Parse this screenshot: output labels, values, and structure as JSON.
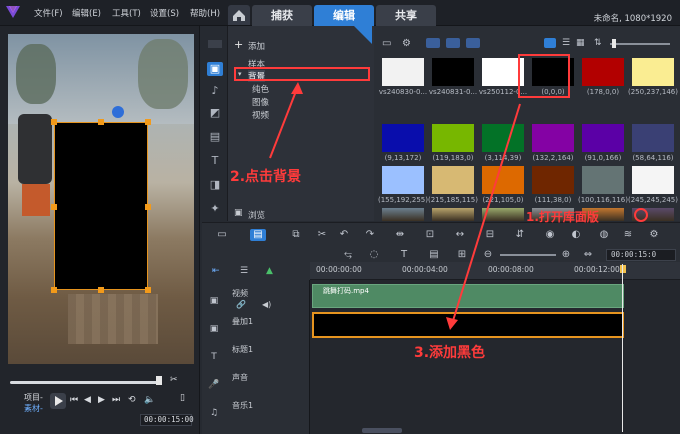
{
  "menubar": {
    "items": [
      "文件(F)",
      "编辑(E)",
      "工具(T)",
      "设置(S)",
      "帮助(H)"
    ]
  },
  "main_tabs": [
    {
      "label": "捕获",
      "active": false
    },
    {
      "label": "编辑",
      "active": true
    },
    {
      "label": "共享",
      "active": false
    }
  ],
  "project_info": "未命名, 1080*1920",
  "library": {
    "add_label": "添加",
    "nav": {
      "sample": "样本",
      "background": "背景",
      "children": [
        "纯色",
        "图像",
        "视频"
      ],
      "browse": "浏览"
    },
    "thumbnails": [
      {
        "label": "vs240830-0...",
        "color": "#f2f2f2"
      },
      {
        "label": "vs240831-0...",
        "color": "#000000"
      },
      {
        "label": "vs250112-0...",
        "color": "#ffffff"
      },
      {
        "label": "(0,0,0)",
        "color": "#000000"
      },
      {
        "label": "(178,0,0)",
        "color": "#b20000"
      },
      {
        "label": "(250,237,146)",
        "color": "#faed92"
      },
      {
        "label": "(9,13,172)",
        "color": "#090dac"
      },
      {
        "label": "(119,183,0)",
        "color": "#77b700"
      },
      {
        "label": "(3,114,39)",
        "color": "#037227"
      },
      {
        "label": "(132,2,164)",
        "color": "#8402a4"
      },
      {
        "label": "(91,0,166)",
        "color": "#5b00a6"
      },
      {
        "label": "(58,64,116)",
        "color": "#3a4074"
      },
      {
        "label": "(155,192,255)",
        "color": "#9bc0ff"
      },
      {
        "label": "(215,185,115)",
        "color": "#d7b973"
      },
      {
        "label": "(221,105,0)",
        "color": "#dd6900"
      },
      {
        "label": "(111,38,0)",
        "color": "#6f2600"
      },
      {
        "label": "(100,116,116)",
        "color": "#647474"
      },
      {
        "label": "(245,245,245)",
        "color": "#f5f5f5"
      }
    ]
  },
  "timeline": {
    "ruler": [
      "00:00:00:00",
      "00:00:04:00",
      "00:00:08:00",
      "00:00:12:00",
      "00:00:15:0"
    ],
    "tracks": {
      "video": "视频",
      "overlay": "叠加1",
      "title": "标题1",
      "voice": "声音",
      "music": "音乐1"
    },
    "video_clip": "跳舞打码.mp4"
  },
  "preview": {
    "mode_project": "项目-",
    "mode_clip": "素材-",
    "timecode": "00:00:15:00"
  },
  "annotations": {
    "step1": "1.打开库面版",
    "step2": "2.点击背景",
    "step3": "3.添加黑色"
  },
  "colors": {
    "accent": "#2f7fd6",
    "annotation": "#ff3b3b",
    "selection": "#e6941f"
  }
}
